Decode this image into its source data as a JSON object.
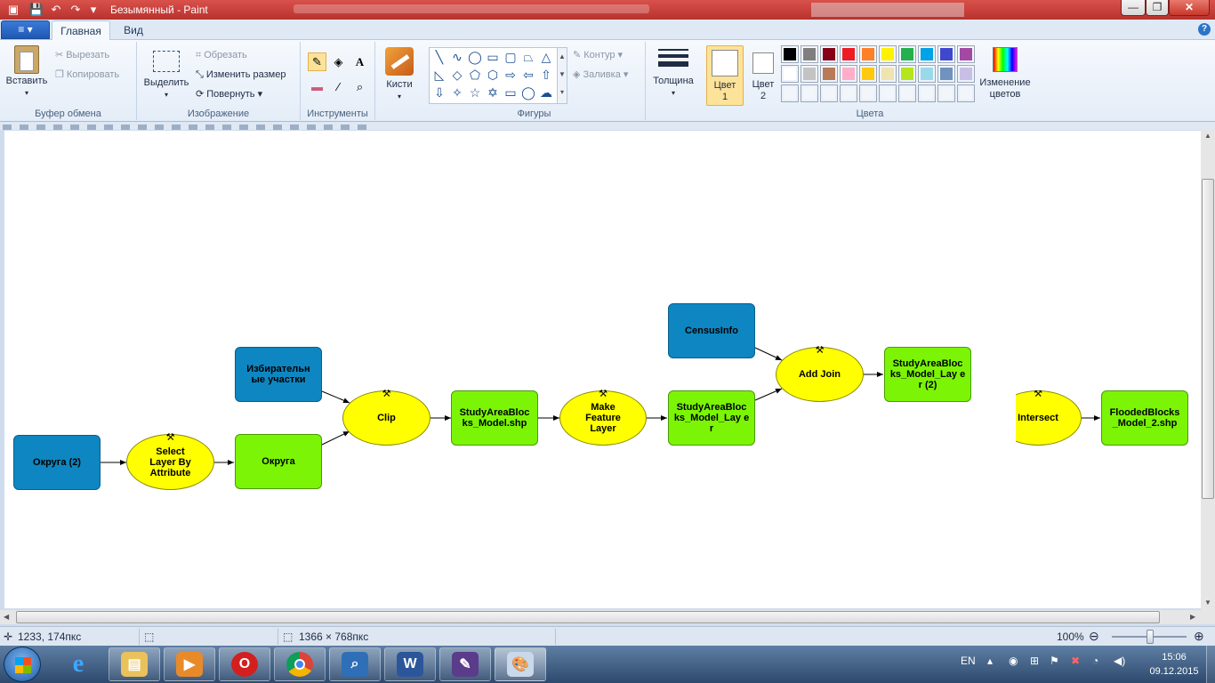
{
  "window": {
    "title": "Безымянный - Paint",
    "controls": {
      "minimize": "—",
      "maximize": "❐",
      "close": "✕"
    }
  },
  "quick_access": [
    "save-icon",
    "undo-icon",
    "redo-icon",
    "dropdown-icon"
  ],
  "tabs": {
    "file_label": "≡ ▾",
    "home": "Главная",
    "view": "Вид",
    "help": "?"
  },
  "ribbon": {
    "clipboard": {
      "group_label": "Буфер обмена",
      "paste": "Вставить",
      "cut": "Вырезать",
      "copy": "Копировать"
    },
    "image": {
      "group_label": "Изображение",
      "select": "Выделить",
      "crop": "Обрезать",
      "resize": "Изменить размер",
      "rotate": "Повернуть"
    },
    "tools": {
      "group_label": "Инструменты"
    },
    "brushes": {
      "label": "Кисти"
    },
    "shapes": {
      "group_label": "Фигуры",
      "outline": "Контур",
      "fill": "Заливка"
    },
    "size": {
      "label": "Толщина"
    },
    "colors": {
      "group_label": "Цвета",
      "color1_line1": "Цвет",
      "color1_line2": "1",
      "color2_line1": "Цвет",
      "color2_line2": "2",
      "edit_line1": "Изменение",
      "edit_line2": "цветов",
      "color1": "#000000",
      "color2": "#ffffff",
      "palette_row1": [
        "#000000",
        "#7f7f7f",
        "#880015",
        "#ed1c24",
        "#ff7f27",
        "#fff200",
        "#22b14c",
        "#00a2e8",
        "#3f48cc",
        "#a349a4"
      ],
      "palette_row2": [
        "#ffffff",
        "#c3c3c3",
        "#b97a57",
        "#ffaec9",
        "#ffc90e",
        "#efe4b0",
        "#b5e61d",
        "#99d9ea",
        "#7092be",
        "#c8bfe7"
      ],
      "palette_row3": [
        "",
        "",
        "",
        "",
        "",
        "",
        "",
        "",
        "",
        ""
      ]
    }
  },
  "model": {
    "data_color": "#0e86c1",
    "result_color": "#7bf505",
    "process_color": "#ffff00",
    "nodes": {
      "okruga2": "Округа (2)",
      "select_layer": "Select Layer By Attribute",
      "okruga": "Округа",
      "izbir": "Избирательн ые участки",
      "clip": "Clip",
      "study_shp": "StudyAreaBloc ks_Model.shp",
      "make_feature": "Make Feature Layer",
      "study_layer": "StudyAreaBloc ks_Model_Lay er",
      "census": "CensusInfo",
      "add_join": "Add Join",
      "study_layer2": "StudyAreaBloc ks_Model_Lay er (2)",
      "intersect": "Intersect",
      "flooded": "FloodedBlocks _Model_2.shp"
    }
  },
  "statusbar": {
    "cursor_pos": "1233, 174пкс",
    "selection_size": "",
    "image_size": "1366 × 768пкс",
    "zoom": "100%"
  },
  "taskbar": {
    "apps": [
      "windows-explorer",
      "media-player",
      "opera",
      "chrome",
      "magnifier",
      "word",
      "pen-tool",
      "paint"
    ],
    "lang": "EN",
    "time": "15:06",
    "date": "09.12.2015"
  }
}
